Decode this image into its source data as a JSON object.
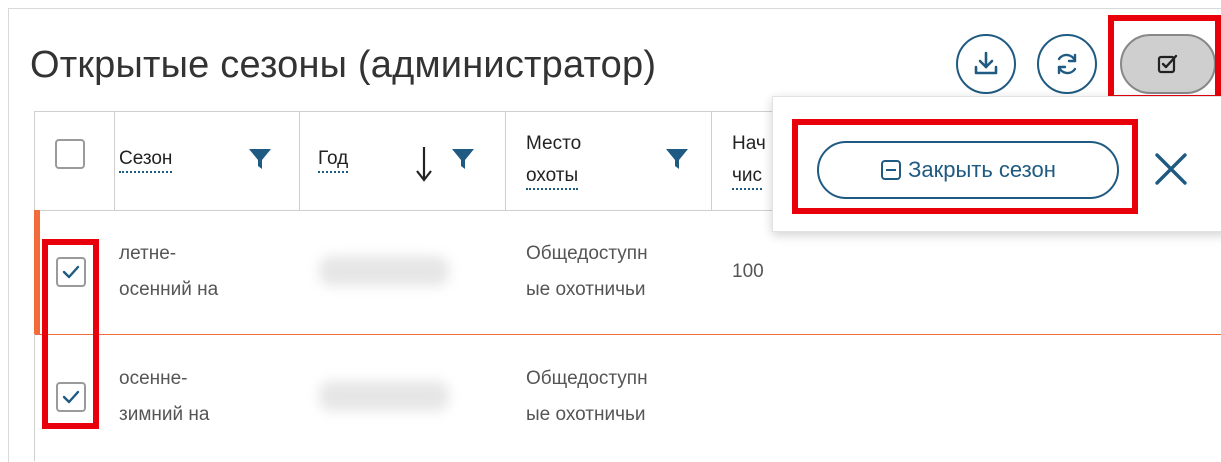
{
  "header": {
    "title": "Открытые сезоны (администратор)"
  },
  "toolbar": {
    "download_icon": "download-icon",
    "refresh_icon": "refresh-icon",
    "select_mode_icon": "checkbox-icon"
  },
  "table": {
    "columns": [
      {
        "label": "Сезон",
        "filter": true
      },
      {
        "label": "Год",
        "sort": "desc",
        "filter": true
      },
      {
        "label_line1": "Место",
        "label_line2": "охоты",
        "filter": true
      },
      {
        "label_line1": "Нач",
        "label_line2": "чис"
      }
    ],
    "rows": [
      {
        "checked": true,
        "season_line1": "летне-",
        "season_line2": "осенний на",
        "year": "",
        "place_line1": "Общедоступн",
        "place_line2": "ые охотничьи",
        "start": "100"
      },
      {
        "checked": true,
        "season_line1": "осенне-",
        "season_line2": "зимний на",
        "year": "",
        "place_line1": "Общедоступн",
        "place_line2": "ые охотничьи",
        "start": ""
      }
    ]
  },
  "popover": {
    "close_season_label": "Закрыть сезон",
    "close_season_icon": "minus-square-icon",
    "dismiss_icon": "close-icon"
  },
  "colors": {
    "accent": "#1f5a82",
    "highlight": "#e8000b",
    "row_marker": "#f26b3a"
  }
}
